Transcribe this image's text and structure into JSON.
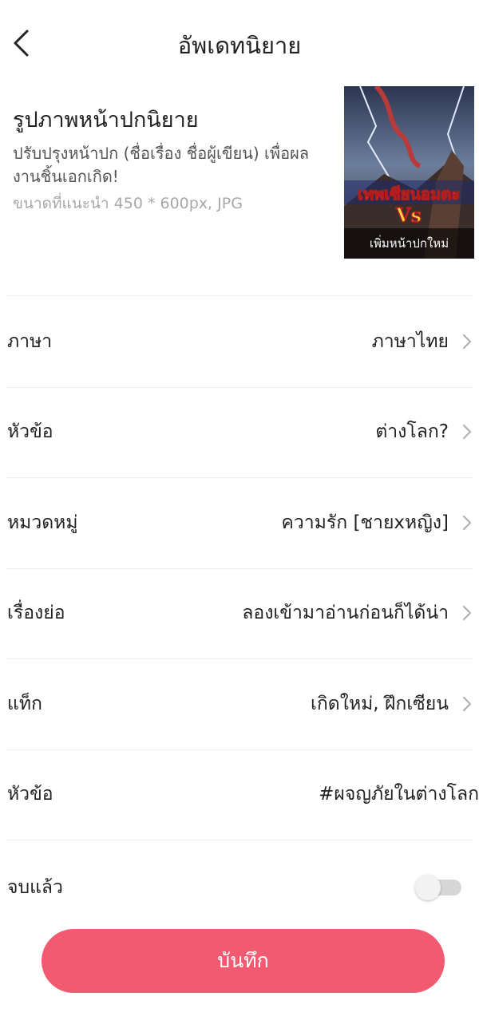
{
  "header": {
    "title": "อัพเดทนิยาย",
    "back_icon": "chevron-left-icon"
  },
  "cover": {
    "title": "รูปภาพหน้าปกนิยาย",
    "description": "ปรับปรุงหน้าปก (ชื่อเรื่อง ชื่อผู้เขียน) เพื่อผลงานชิ้นเอกเกิด!",
    "hint": "ขนาดที่แนะนำ 450 * 600px, JPG",
    "badge": "เพิ่มหน้าปกใหม่",
    "image_text_main": "เทพเซียนอมตะ",
    "image_text_vs": "Vs"
  },
  "rows": [
    {
      "label": "ภาษา",
      "value": "ภาษาไทย",
      "chevron": true
    },
    {
      "label": "หัวข้อ",
      "value": "ต่างโลก?",
      "chevron": true
    },
    {
      "label": "หมวดหมู่",
      "value": "ความรัก [ชายxหญิง]",
      "chevron": true
    },
    {
      "label": "เรื่องย่อ",
      "value": "ลองเข้ามาอ่านก่อนก็ได้น่า",
      "chevron": true
    },
    {
      "label": "แท็ก",
      "value": "เกิดใหม่, ฝึกเซียน",
      "chevron": true
    },
    {
      "label": "หัวข้อ",
      "value": "#ผจญภัยในต่างโลก",
      "chevron": false
    }
  ],
  "completed": {
    "label": "จบแล้ว",
    "on": false
  },
  "save_label": "บันทึก",
  "colors": {
    "accent": "#f25a72",
    "toggle_off": "#d6d6d6"
  }
}
